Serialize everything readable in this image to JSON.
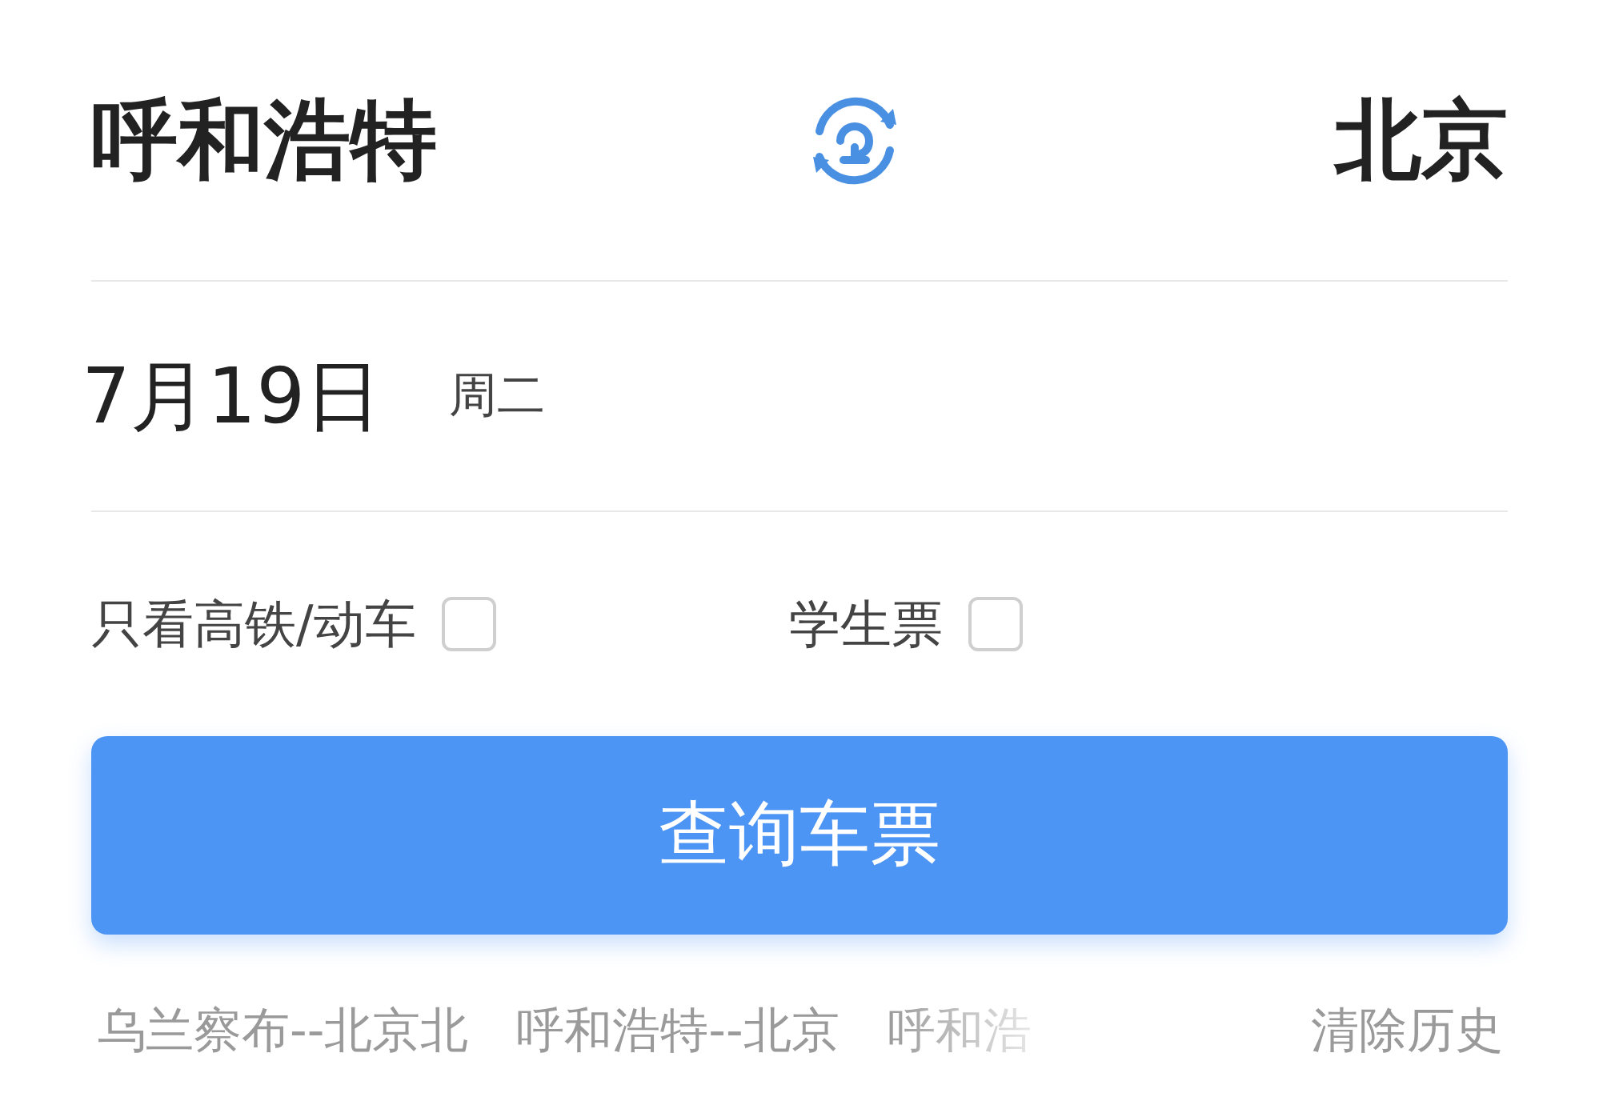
{
  "route": {
    "from": "呼和浩特",
    "to": "北京"
  },
  "date": {
    "day": "7月19日",
    "weekday": "周二"
  },
  "options": [
    {
      "label": "只看高铁/动车",
      "checked": false
    },
    {
      "label": "学生票",
      "checked": false
    }
  ],
  "search_button": "查询车票",
  "history": [
    {
      "label": "乌兰察布--北京北",
      "faded": false
    },
    {
      "label": "呼和浩特--北京",
      "faded": false
    },
    {
      "label": "呼和浩",
      "faded": true
    }
  ],
  "clear_history": "清除历史"
}
